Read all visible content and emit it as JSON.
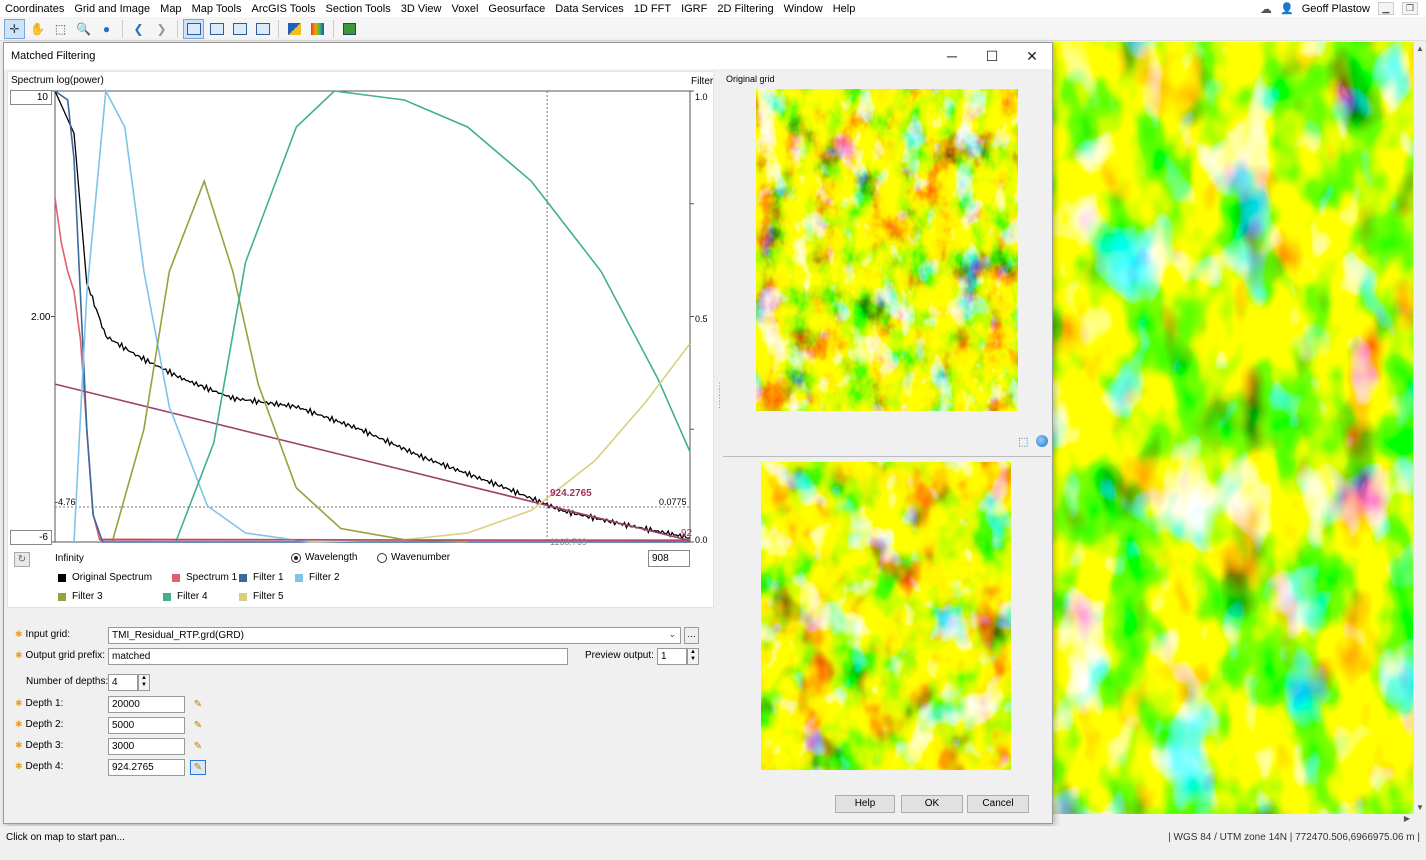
{
  "menu": [
    "Coordinates",
    "Grid and Image",
    "Map",
    "Map Tools",
    "ArcGIS Tools",
    "Section Tools",
    "3D View",
    "Voxel",
    "Geosurface",
    "Data Services",
    "1D FFT",
    "IGRF",
    "2D Filtering",
    "Window",
    "Help"
  ],
  "user": {
    "name": "Geoff Plastow"
  },
  "toolbar_icons": [
    "pointer-tool",
    "pan-tool",
    "zoom-window-tool",
    "zoom-tool",
    "globe-tool",
    "back-arrow",
    "forward-arrow",
    "view-1",
    "view-2",
    "view-3",
    "view-4",
    "layers-tool",
    "color-tool",
    "map-tool"
  ],
  "dialog": {
    "title": "Matched Filtering",
    "chart": {
      "spectrum_label": "Spectrum log(power)",
      "filter_label": "Filter",
      "y_left_ticks": [
        "10",
        "2.00",
        "-4.76",
        "-6"
      ],
      "y_right_ticks": [
        "1.0",
        "0.5",
        "0.0775",
        "0.0"
      ],
      "cursor_value": "924.2765",
      "cursor_bottom": "1168.769",
      "right_edge_label": "92",
      "x_left_label": "Infinity",
      "x_input_value": "908",
      "radio_wavelength": "Wavelength",
      "radio_wavenumber": "Wavenumber",
      "selected_mode": "Wavelength",
      "legend": [
        {
          "name": "Original Spectrum",
          "color": "#000000"
        },
        {
          "name": "Spectrum 1",
          "color": "#e06070"
        },
        {
          "name": "Filter 1",
          "color": "#3a6a9a"
        },
        {
          "name": "Filter 2",
          "color": "#7fc4e8"
        },
        {
          "name": "Filter 3",
          "color": "#98a040"
        },
        {
          "name": "Filter 4",
          "color": "#40b090"
        },
        {
          "name": "Filter 5",
          "color": "#d8d080"
        }
      ]
    },
    "chart_data": {
      "type": "line",
      "title": "",
      "ylabel": "Spectrum log(power)",
      "y2label": "Filter",
      "xlabel": "",
      "x_axis": "Wavelength",
      "ylim": [
        -6,
        10
      ],
      "y2lim": [
        0,
        1
      ],
      "series": [
        {
          "name": "Original Spectrum",
          "axis": "left",
          "color": "#000000",
          "x": [
            0.0,
            0.03,
            0.05,
            0.08,
            0.13,
            0.2,
            0.28,
            0.38,
            0.48,
            0.58,
            0.7,
            0.8,
            0.9,
            1.0
          ],
          "y": [
            10,
            8.5,
            3.2,
            1.3,
            0.6,
            -0.2,
            -0.9,
            -1.2,
            -2.0,
            -3.0,
            -4.0,
            -4.9,
            -5.4,
            -5.85
          ]
        },
        {
          "name": "Spectrum 1",
          "axis": "left",
          "color": "#e06070",
          "x": [
            0.0,
            0.01,
            0.02,
            0.03,
            0.04,
            0.05,
            0.06,
            0.07,
            1.0
          ],
          "y": [
            6.2,
            4.6,
            3.6,
            2.9,
            1.2,
            -2.0,
            -5.0,
            -5.9,
            -5.95
          ]
        },
        {
          "name": "Regional line",
          "axis": "left",
          "color": "#a04070",
          "x": [
            0.0,
            1.0
          ],
          "y": [
            -0.4,
            -5.95
          ]
        },
        {
          "name": "Filter 1",
          "axis": "right",
          "color": "#3a6a9a",
          "x": [
            0.0,
            0.02,
            0.03,
            0.04,
            0.05,
            0.06,
            0.075,
            1.0
          ],
          "y": [
            1.0,
            0.98,
            0.85,
            0.55,
            0.25,
            0.06,
            0.0,
            0.0
          ]
        },
        {
          "name": "Filter 2",
          "axis": "right",
          "color": "#7fc4e8",
          "x": [
            0.03,
            0.05,
            0.08,
            0.11,
            0.14,
            0.18,
            0.24,
            0.3,
            0.4
          ],
          "y": [
            0.0,
            0.55,
            1.0,
            0.92,
            0.6,
            0.3,
            0.08,
            0.02,
            0.0
          ]
        },
        {
          "name": "Filter 3",
          "axis": "right",
          "color": "#98a040",
          "x": [
            0.09,
            0.14,
            0.18,
            0.235,
            0.28,
            0.32,
            0.38,
            0.45,
            0.55,
            0.65
          ],
          "y": [
            0.0,
            0.25,
            0.6,
            0.8,
            0.6,
            0.35,
            0.12,
            0.03,
            0.005,
            0.0
          ]
        },
        {
          "name": "Filter 4",
          "axis": "right",
          "color": "#40b090",
          "x": [
            0.19,
            0.25,
            0.3,
            0.38,
            0.44,
            0.55,
            0.65,
            0.75,
            0.86,
            0.95,
            1.0
          ],
          "y": [
            0.0,
            0.22,
            0.62,
            0.92,
            1.0,
            0.98,
            0.92,
            0.8,
            0.6,
            0.36,
            0.2
          ]
        },
        {
          "name": "Filter 5",
          "axis": "right",
          "color": "#d8d080",
          "x": [
            0.4,
            0.55,
            0.65,
            0.75,
            0.85,
            0.93,
            1.0
          ],
          "y": [
            0.0,
            0.005,
            0.02,
            0.07,
            0.18,
            0.31,
            0.44
          ]
        }
      ],
      "markers": {
        "cursor_x": 0.775,
        "hline_left": -4.76,
        "hline_right": 0.0775
      }
    },
    "form": {
      "input_grid_label": "Input grid:",
      "input_grid_value": "TMI_Residual_RTP.grd(GRD)",
      "output_prefix_label": "Output grid prefix:",
      "output_prefix_value": "matched",
      "preview_output_label": "Preview output:",
      "preview_output_value": "1",
      "num_depths_label": "Number of depths:",
      "num_depths_value": "4",
      "depths": [
        {
          "label": "Depth 1:",
          "value": "20000"
        },
        {
          "label": "Depth 2:",
          "value": "5000"
        },
        {
          "label": "Depth 3:",
          "value": "3000"
        },
        {
          "label": "Depth 4:",
          "value": "924.2765"
        }
      ]
    },
    "original_grid_label": "Original grid",
    "buttons": {
      "help": "Help",
      "ok": "OK",
      "cancel": "Cancel"
    }
  },
  "status": {
    "left": "Click on map to start pan...",
    "right": "| WGS 84 / UTM zone 14N  |  772470.506,6966975.06 m  |"
  }
}
